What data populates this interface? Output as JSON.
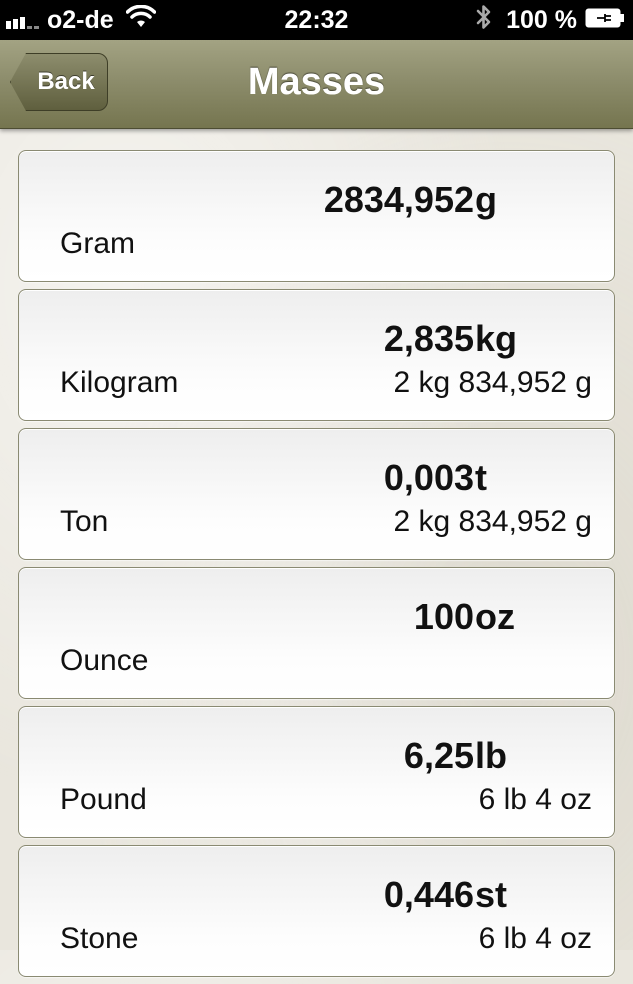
{
  "status_bar": {
    "carrier": "o2-de",
    "time": "22:32",
    "battery": "100 %"
  },
  "nav": {
    "back_label": "Back",
    "title": "Masses"
  },
  "rows": [
    {
      "name": "Gram",
      "value": "2834,952",
      "unit": "g",
      "detail": ""
    },
    {
      "name": "Kilogram",
      "value": "2,835",
      "unit": "kg",
      "detail": "2 kg 834,952 g"
    },
    {
      "name": "Ton",
      "value": "0,003",
      "unit": "t",
      "detail": "2 kg 834,952 g"
    },
    {
      "name": "Ounce",
      "value": "100",
      "unit": "oz",
      "detail": ""
    },
    {
      "name": "Pound",
      "value": "6,25",
      "unit": "lb",
      "detail": "6 lb 4 oz"
    },
    {
      "name": "Stone",
      "value": "0,446",
      "unit": "st",
      "detail": "6 lb 4 oz"
    }
  ],
  "colors": {
    "nav_bar": "#8d8d6c",
    "status_bar": "#000000",
    "cell_border": "#8a8a72"
  }
}
